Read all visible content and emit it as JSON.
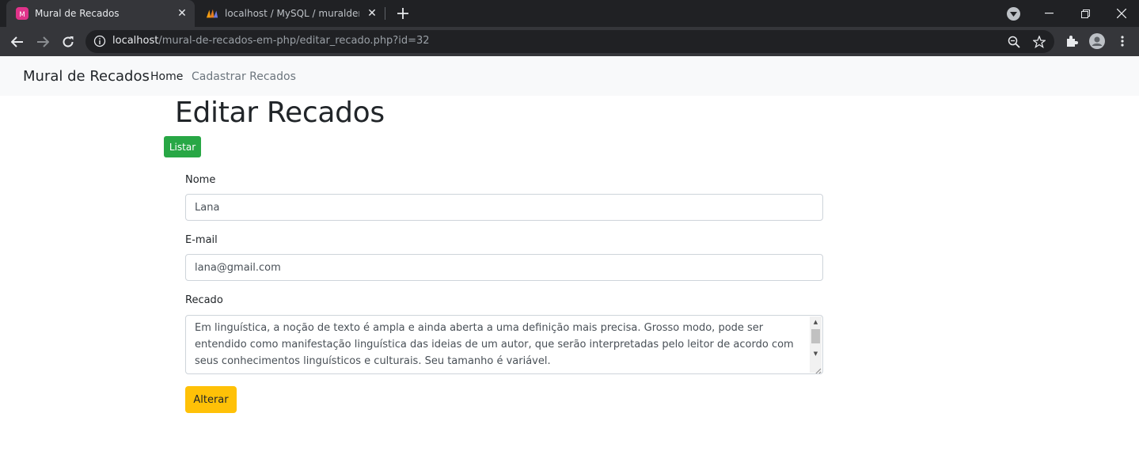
{
  "browser": {
    "tabs": [
      {
        "title": "Mural de Recados",
        "favicon": "app-favicon"
      },
      {
        "title": "localhost / MySQL / muraldereca",
        "favicon": "phpmyadmin-favicon"
      }
    ],
    "url_host": "localhost",
    "url_path": "/mural-de-recados-em-php/editar_recado.php?id=32"
  },
  "navbar": {
    "brand": "Mural de Recados",
    "links": [
      "Home",
      "Cadastrar Recados"
    ]
  },
  "page": {
    "title": "Editar Recados",
    "list_button": "Listar"
  },
  "form": {
    "name_label": "Nome",
    "name_value": "Lana",
    "email_label": "E-mail",
    "email_value": "lana@gmail.com",
    "message_label": "Recado",
    "message_value": "Em linguística, a noção de texto é ampla e ainda aberta a uma definição mais precisa. Grosso modo, pode ser entendido como manifestação linguística das ideias de um autor, que serão interpretadas pelo leitor de acordo com seus conhecimentos linguísticos e culturais. Seu tamanho é variável.",
    "submit_label": "Alterar"
  },
  "colors": {
    "listar": "#28a745",
    "alterar": "#ffc107",
    "navbar_bg": "#f8f9fa"
  }
}
